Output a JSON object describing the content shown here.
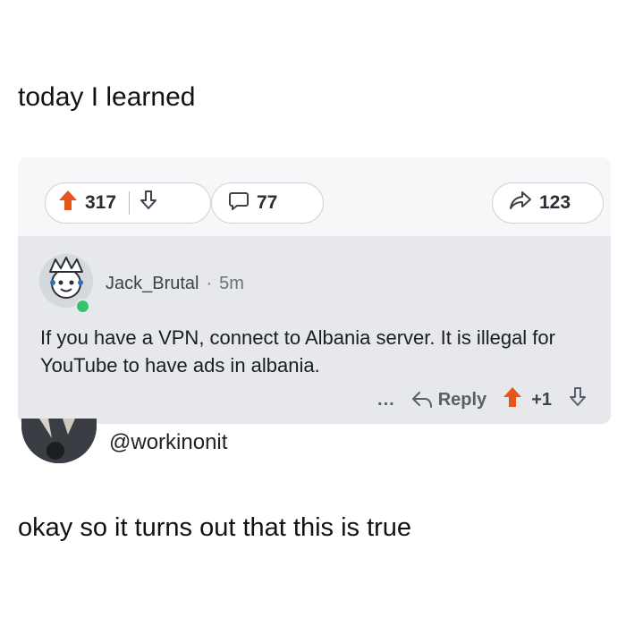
{
  "caption_top": "today I learned",
  "post": {
    "upvotes": "317",
    "comments": "77",
    "shares": "123",
    "colors": {
      "upvote": "#e8551a",
      "card_bg": "#e6e8eb",
      "online": "#39c16c"
    }
  },
  "comment": {
    "username": "Jack_Brutal",
    "separator": "·",
    "time": "5m",
    "text": "If you have a VPN, connect to Albania server.  It is illegal for YouTube to have ads in albania.",
    "more": "...",
    "reply_label": "Reply",
    "score": "+1"
  },
  "tweet": {
    "handle": "@workinonit",
    "caption": "okay so it turns out that this is true"
  }
}
